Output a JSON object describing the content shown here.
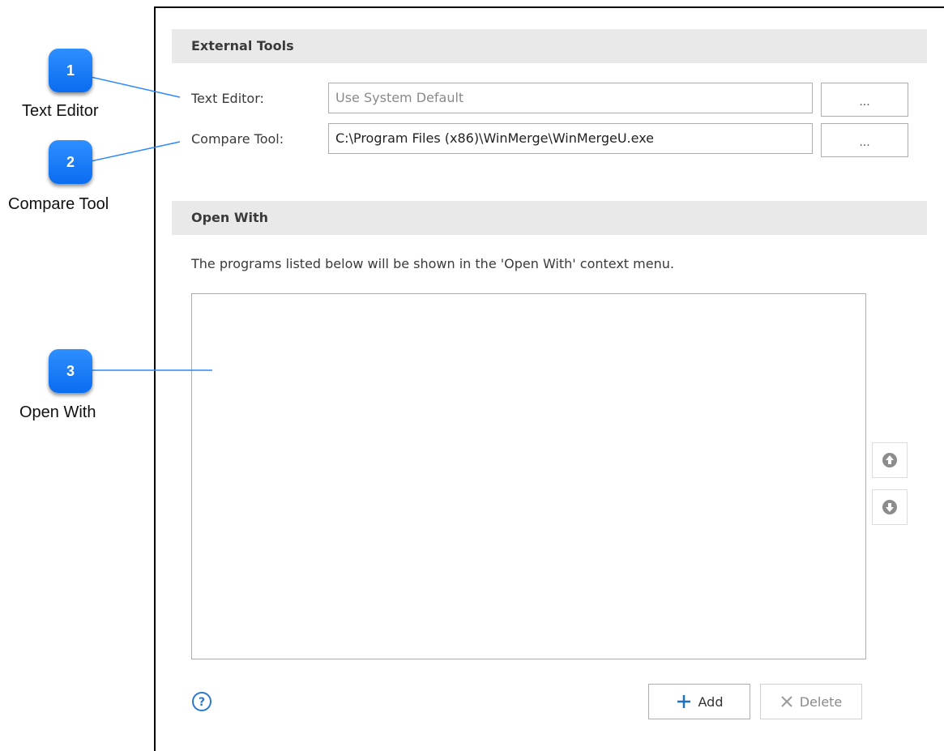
{
  "external_tools": {
    "header": "External Tools",
    "text_editor_label": "Text Editor:",
    "text_editor_placeholder": "Use System Default",
    "compare_tool_label": "Compare Tool:",
    "compare_tool_value": "C:\\Program Files (x86)\\WinMerge\\WinMergeU.exe",
    "browse_label": "..."
  },
  "open_with": {
    "header": "Open With",
    "description": "The programs listed below will be shown in the 'Open With' context menu.",
    "add_label": "Add",
    "delete_label": "Delete"
  },
  "callouts": [
    {
      "number": "1",
      "label": "Text Editor"
    },
    {
      "number": "2",
      "label": "Compare Tool"
    },
    {
      "number": "3",
      "label": "Open With"
    }
  ],
  "colors": {
    "badge": "#1a7cff",
    "header_bg": "#e9e9e9",
    "help_icon": "#2a78d0",
    "add_icon": "#1f6fc5"
  }
}
